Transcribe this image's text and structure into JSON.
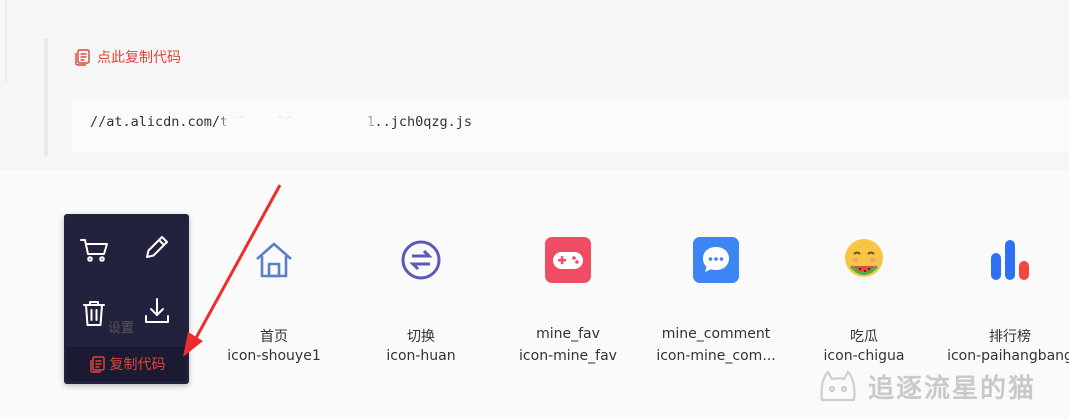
{
  "snippet": {
    "copy_link_label": "点此复制代码",
    "code_text": "//at.alicdn.com/t/font_26        _1..jch0qzg.js"
  },
  "hover_card": {
    "settings_label": "设置",
    "copy_button_label": "复制代码",
    "icons": [
      "cart-icon",
      "edit-icon",
      "trash-icon",
      "download-icon"
    ]
  },
  "icons": [
    {
      "name": "首页",
      "code": "icon-shouye1",
      "glyph": "home-icon",
      "color": "#5a7fc7"
    },
    {
      "name": "切换",
      "code": "icon-huan",
      "glyph": "switch-icon",
      "color": "#5b5ab8"
    },
    {
      "name": "mine_fav",
      "code": "icon-mine_fav",
      "glyph": "gamepad-icon",
      "color": "#ef4d63"
    },
    {
      "name": "mine_comment",
      "code": "icon-mine_com...",
      "glyph": "comment-icon",
      "color": "#3d85f5"
    },
    {
      "name": "吃瓜",
      "code": "icon-chigua",
      "glyph": "emoji-watermelon-icon",
      "color": "#f7c642"
    },
    {
      "name": "排行榜",
      "code": "icon-paihangbang",
      "glyph": "ranking-icon",
      "color": "#2f6ff0"
    }
  ],
  "watermark": {
    "text": "追逐流星的猫"
  },
  "colors": {
    "accent_red": "#e0443b",
    "hover_bg": "#23223e"
  }
}
